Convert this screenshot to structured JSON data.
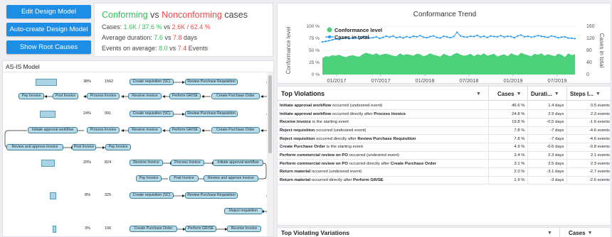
{
  "buttons": {
    "edit_design_model": "Edit Design Model",
    "auto_create_design_model": "Auto-create Design Model",
    "show_root_causes": "Show Root Causes"
  },
  "summary": {
    "conforming": "Conforming",
    "vs": "vs",
    "nonconforming": "Nonconforming",
    "cases_suffix": "cases",
    "cases_label": "Cases:",
    "cases_conf": "1.6K / 37.6 %",
    "cases_nonconf": "2.6K / 62.4 %",
    "duration_label": "Average duration:",
    "duration_conf": "7.6",
    "duration_nonconf": "7.8",
    "duration_unit": "days",
    "events_label": "Events on average:",
    "events_conf": "8.0",
    "events_nonconf": "7.4",
    "events_unit": "Events"
  },
  "asis": {
    "title": "AS-IS Model",
    "rows": [
      {
        "pct": "38%",
        "count": "1562",
        "bar": 0.38
      },
      {
        "pct": "24%",
        "count": "991",
        "bar": 0.24
      },
      {
        "pct": "20%",
        "count": "824",
        "bar": 0.2
      },
      {
        "pct": "8%",
        "count": "325",
        "bar": 0.08
      },
      {
        "pct": "3%",
        "count": "106",
        "bar": 0.03
      }
    ],
    "nodes": {
      "r1a": [
        "Create requisition (SC)",
        "Review Purchase Requisition"
      ],
      "r1b": [
        "Pay Invoice",
        "Post Invoice",
        "Process Invoice",
        "Receive Invoice",
        "Perform GR/SE",
        "Create Purchase Order"
      ],
      "r2a": [
        "Create requisition (SC)",
        "Review Purchase Requisition"
      ],
      "r2b": [
        "Initiate approval workflow",
        "Process Invoice",
        "Receive Invoice",
        "Perform GR/SE",
        "Create Purchase Order"
      ],
      "r2c": [
        "Review and approve invoice",
        "Post Invoice",
        "Pay Invoice"
      ],
      "r3a": [
        "Receive Invoice",
        "Process Invoice",
        "Initiate approval workflow"
      ],
      "r3b": [
        "Pay Invoice",
        "Post Invoice",
        "Review and approve invoice"
      ],
      "r4a": [
        "Create requisition (SC)",
        "Review Purchase Requisition"
      ],
      "r4b": [
        "Reject requisition"
      ],
      "r5a": [
        "Create Purchase Order",
        "Perform GR/SE",
        "Receive Invoice"
      ]
    }
  },
  "chart_data": {
    "type": "line",
    "title": "Conformance Trend",
    "x_ticks": [
      "01/2017",
      "07/2017",
      "01/2018",
      "07/2018",
      "01/2019",
      "07/2019"
    ],
    "y_left_ticks": [
      "100 %",
      "75 %",
      "50 %",
      "25 %",
      "0 %"
    ],
    "y_right_ticks": [
      "160",
      "120",
      "80",
      "40",
      "0"
    ],
    "ylabel_left": "Conformance level",
    "ylabel_right": "Cases in total",
    "ylim_left": [
      0,
      100
    ],
    "ylim_right": [
      0,
      160
    ],
    "legend_position": "top-left",
    "series": [
      {
        "name": "Conformance level",
        "kind": "area",
        "color": "#4dd07a",
        "axis": "left",
        "values": [
          34,
          38,
          37,
          40,
          39,
          41,
          38,
          36,
          39,
          40,
          38,
          37,
          42,
          45,
          43,
          41,
          44,
          40,
          42,
          43,
          41,
          39,
          38,
          44,
          40,
          42,
          41,
          39,
          43,
          42,
          38,
          40,
          44,
          41,
          39,
          37,
          43,
          40,
          38,
          42,
          45,
          41,
          39,
          40,
          43,
          38,
          42,
          40,
          44,
          39,
          41,
          43,
          37,
          40,
          42,
          38,
          44,
          41,
          39,
          45,
          42,
          40,
          38,
          43,
          41,
          44,
          39,
          42,
          40,
          38,
          43,
          41,
          36,
          44,
          40,
          42
        ]
      },
      {
        "name": "Cases in total",
        "kind": "line",
        "color": "#2196f3",
        "axis": "right",
        "values": [
          108,
          110,
          112,
          115,
          118,
          116,
          120,
          122,
          119,
          121,
          123,
          118,
          124,
          126,
          121,
          122,
          125,
          120,
          123,
          127,
          124,
          128,
          122,
          125,
          121,
          126,
          123,
          127,
          125,
          129,
          124,
          122,
          126,
          128,
          123,
          121,
          127,
          125,
          122,
          126,
          140,
          128,
          125,
          124,
          127,
          126,
          130,
          124,
          127,
          123,
          128,
          126,
          125,
          129,
          124,
          127,
          126,
          122,
          128,
          131,
          125,
          127,
          124,
          126,
          129,
          127,
          125,
          123,
          128,
          126,
          122,
          124,
          125,
          121,
          120,
          119
        ]
      }
    ]
  },
  "violations": {
    "title": "Top Violations",
    "columns": [
      "Cases",
      "Durati...",
      "Steps I..."
    ],
    "rows": [
      {
        "a": "Initiate approval workflow",
        "b": " occurred (undesired event)",
        "c": "",
        "cases": "46.6 %",
        "dur": "1.4 days",
        "steps": "0.5 events"
      },
      {
        "a": "Initiate approval workflow",
        "b": " occurred directly after ",
        "c": "Process Invoice",
        "cases": "24.8 %",
        "dur": "2.9 days",
        "steps": "2.3 events"
      },
      {
        "a": "Receive invoice",
        "b": " is the starting event",
        "c": "",
        "cases": "19.8 %",
        "dur": "-0.5 days",
        "steps": "-1.6 events"
      },
      {
        "a": "Reject requisition",
        "b": " occurred (undesired event)",
        "c": "",
        "cases": "7.8 %",
        "dur": "-7 days",
        "steps": "-4.6 events"
      },
      {
        "a": "Reject requisition",
        "b": " occurred directly after ",
        "c": "Review Purchase Requisition",
        "cases": "7.8 %",
        "dur": "-7 days",
        "steps": "-4.6 events"
      },
      {
        "a": "Create Purchase Order",
        "b": " is the starting event",
        "c": "",
        "cases": "4.9 %",
        "dur": "-0.6 days",
        "steps": "-0.8 events"
      },
      {
        "a": "Perform commercial review on PO",
        "b": " occurred (undesired event)",
        "c": "",
        "cases": "3.4 %",
        "dur": "2.3 days",
        "steps": "2.1 events"
      },
      {
        "a": "Perform commercial review on PO",
        "b": " occurred directly after ",
        "c": "Create Purchase Order",
        "cases": "3.1 %",
        "dur": "2.5 days",
        "steps": "2.3 events"
      },
      {
        "a": "Return material",
        "b": " occurred (undesired event)",
        "c": "",
        "cases": "2.0 %",
        "dur": "-3.1 days",
        "steps": "-2.7 events"
      },
      {
        "a": "Return material",
        "b": " occurred directly after ",
        "c": "Perform GR/SE",
        "cases": "1.9 %",
        "dur": "-3 days",
        "steps": "-2.6 events"
      }
    ]
  },
  "variations": {
    "title": "Top Violating Variations",
    "column": "Cases"
  }
}
